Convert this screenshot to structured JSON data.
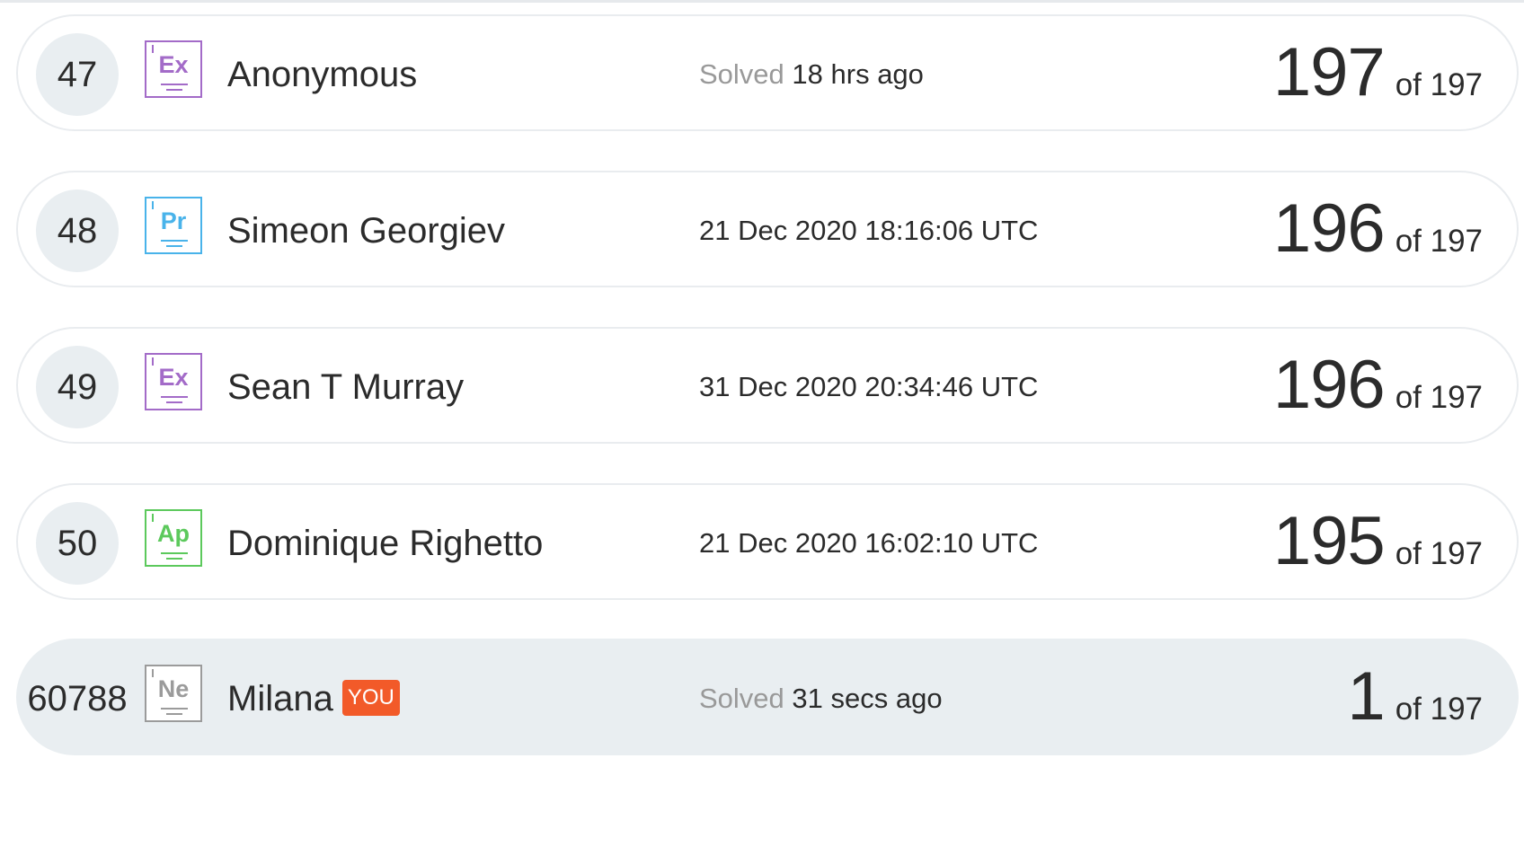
{
  "leaderboard": {
    "of_label": "of 197",
    "solved_prefix": "Solved",
    "rows": [
      {
        "rank": "47",
        "element": {
          "symbol": "Ex",
          "color": "#a36bc8",
          "icon": "element-ex-icon"
        },
        "name": "Anonymous",
        "time": "18 hrs ago",
        "score": "197"
      },
      {
        "rank": "48",
        "element": {
          "symbol": "Pr",
          "color": "#49b3ea",
          "icon": "element-pr-icon"
        },
        "name": "Simeon Georgiev",
        "time": "21 Dec 2020 18:16:06 UTC",
        "score": "196"
      },
      {
        "rank": "49",
        "element": {
          "symbol": "Ex",
          "color": "#a36bc8",
          "icon": "element-ex-icon"
        },
        "name": "Sean T Murray",
        "time": "31 Dec 2020 20:34:46 UTC",
        "score": "196"
      },
      {
        "rank": "50",
        "element": {
          "symbol": "Ap",
          "color": "#5cc95c",
          "icon": "element-ap-icon"
        },
        "name": "Dominique Righetto",
        "time": "21 Dec 2020 16:02:10 UTC",
        "score": "195"
      },
      {
        "rank": "60788",
        "element": {
          "symbol": "Ne",
          "color": "#9b9b9b",
          "icon": "element-ne-icon"
        },
        "name": "Milana",
        "badge": "YOU",
        "time": "31 secs ago",
        "score": "1"
      }
    ]
  },
  "colors": {
    "you_badge": "#f25a29",
    "you_row_bg": "#e9eef1",
    "rank_circle": "#e9eef1"
  }
}
